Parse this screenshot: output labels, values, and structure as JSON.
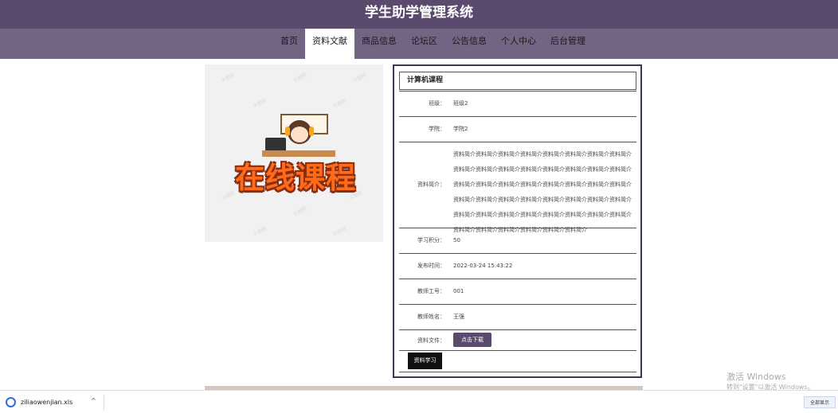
{
  "header": {
    "title": "学生助学管理系统"
  },
  "nav": {
    "items": [
      "首页",
      "资料文献",
      "商品信息",
      "论坛区",
      "公告信息",
      "个人中心",
      "后台管理"
    ],
    "active": "资料文献"
  },
  "image": {
    "text": "在线课程",
    "watermark": "千图网"
  },
  "detail": {
    "title": "计算机课程",
    "rows": [
      {
        "label": "班级：",
        "value": "班级2"
      },
      {
        "label": "学院：",
        "value": "学院2"
      },
      {
        "label": "资料简介：",
        "value": "资料简介资料简介资料简介资料简介资料简介资料简介资料简介资料简介资料简介资料简介资料简介资料简介资料简介资料简介资料简介资料简介资料简介资料简介资料简介资料简介资料简介资料简介资料简介资料简介资料简介资料简介资料简介资料简介资料简介资料简介资料简介资料简介资料简介资料简介资料简介资料简介资料简介资料简介资料简介资料简介资料简介资料简介资料简介资料简介资料简介资料简介"
      },
      {
        "label": "学习积分：",
        "value": "50"
      },
      {
        "label": "发布时间：",
        "value": "2022-03-24 15:43:22"
      },
      {
        "label": "教师工号：",
        "value": "001"
      },
      {
        "label": "教师姓名：",
        "value": "王强"
      }
    ],
    "file_label": "资料文件：",
    "download_button": "点击下载",
    "study_button": "资料学习"
  },
  "windows": {
    "activate_title": "激活 Windows",
    "activate_sub": "转到\"设置\"以激活 Windows。"
  },
  "download_bar": {
    "filename": "ziliaowenjian.xls",
    "show_all": "全部显示"
  }
}
